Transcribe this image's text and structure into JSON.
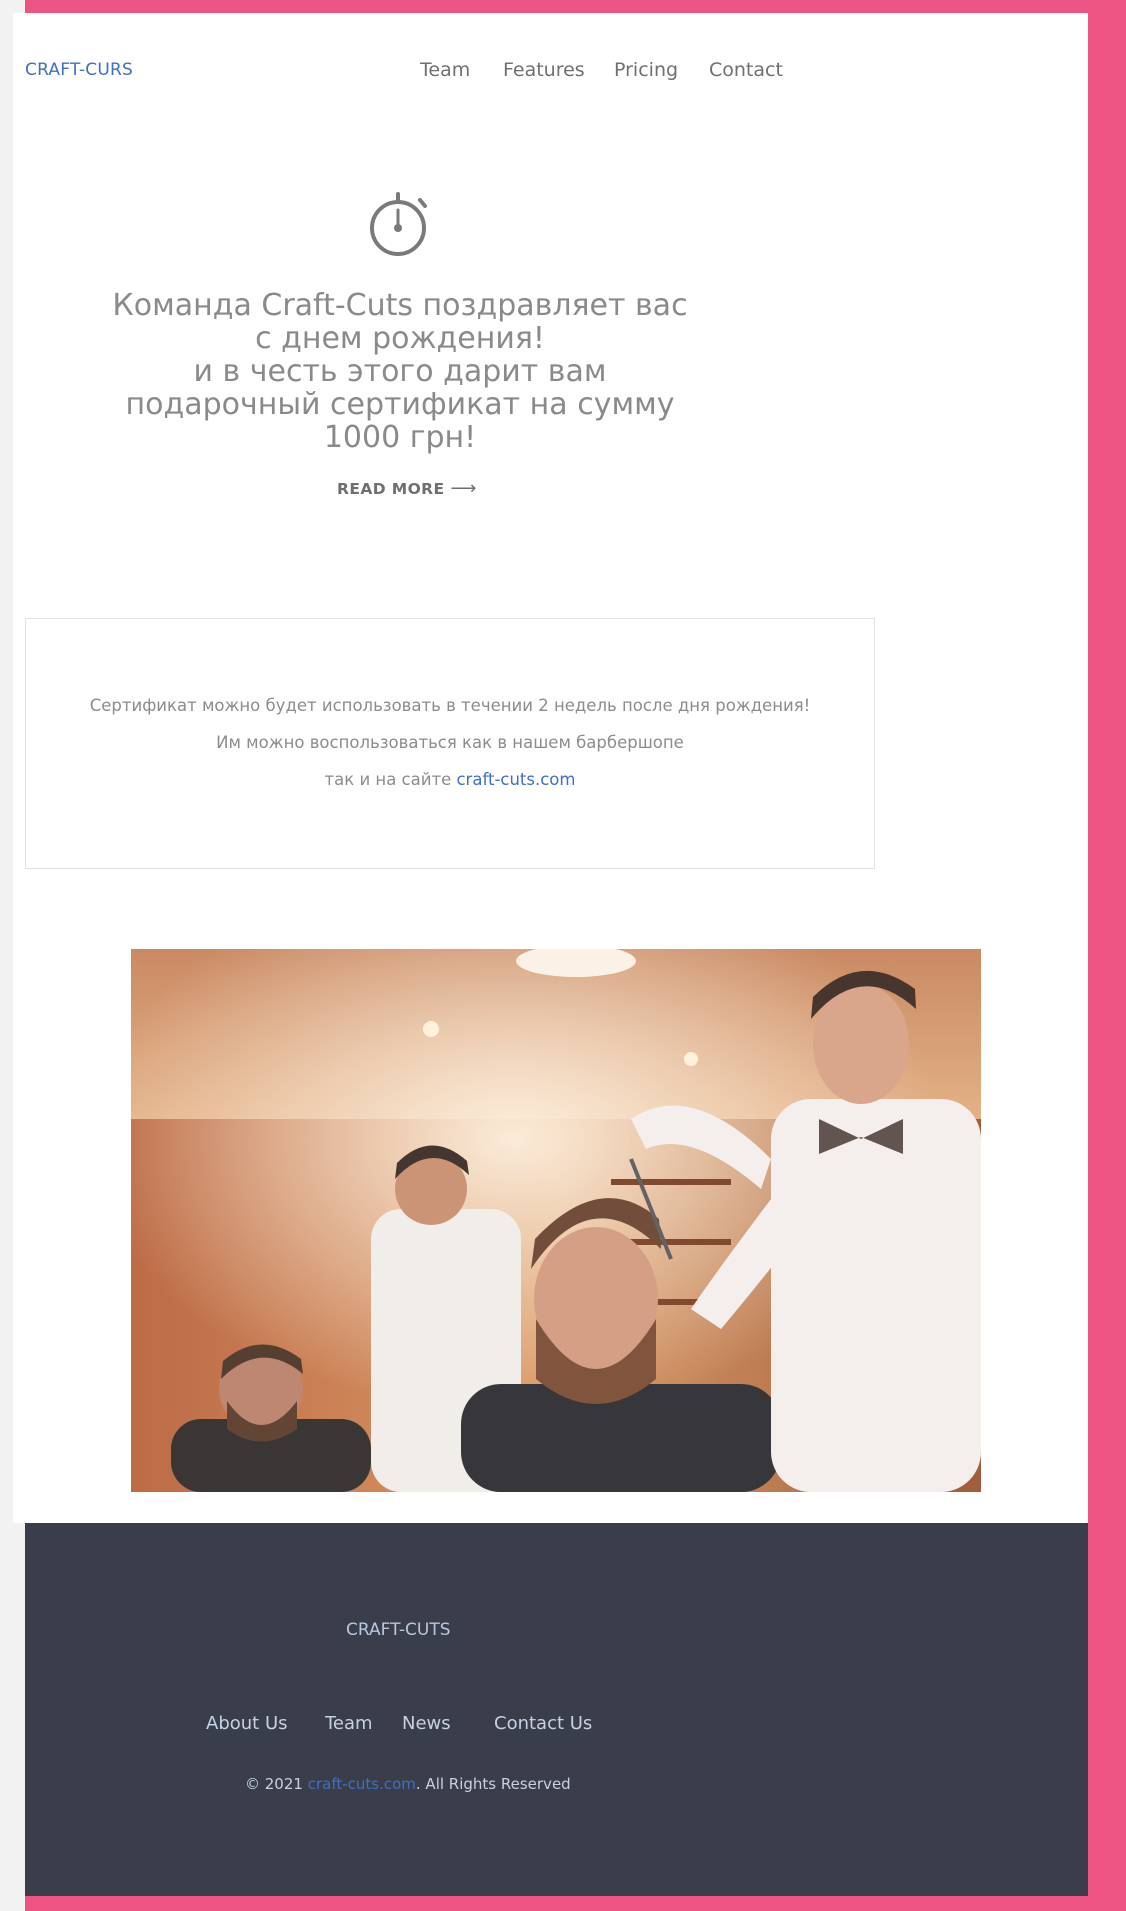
{
  "brand": "CRAFT-CURS",
  "nav": {
    "team": "Team",
    "features": "Features",
    "pricing": "Pricing",
    "contact": "Contact"
  },
  "hero": {
    "icon": "stopwatch-icon",
    "lines": [
      "Команда Craft-Cuts поздравляет вас",
      "с днем рождения!",
      "и в честь этого дарит вам",
      "подарочный сертификат на сумму",
      "1000 грн!"
    ],
    "read_more": "READ MORE",
    "read_more_icon": "arrow-right-icon"
  },
  "info": {
    "line1": "Сертификат можно будет использовать в течении 2 недель после дня рождения!",
    "line2": "Им можно воспользоваться как в нашем барбершопе",
    "line3_prefix": "так и на сайте ",
    "line3_link": "craft-cuts.com"
  },
  "footer": {
    "brand": "CRAFT-CUTS",
    "links": {
      "about": "About Us",
      "team": "Team",
      "news": "News",
      "contact": "Contact Us"
    },
    "copyright_prefix": "© 2021 ",
    "copyright_link": "craft-cuts.com",
    "copyright_suffix": ". All Rights Reserved"
  },
  "colors": {
    "accent_pink": "#ec5583",
    "link_blue": "#3f6ec6",
    "footer_bg": "#393e4a"
  }
}
